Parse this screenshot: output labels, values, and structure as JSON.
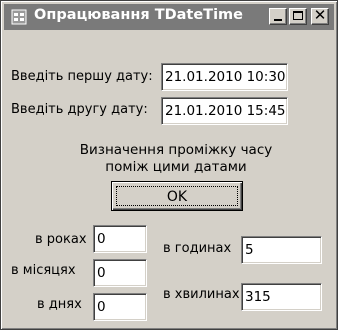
{
  "window": {
    "title": "Опрацювання TDateTime",
    "title_icon": "app-icon",
    "buttons": {
      "minimize": "minimize-icon",
      "maximize": "maximize-icon",
      "close": "✕"
    }
  },
  "form": {
    "first_date_label": "Введіть першу дату:",
    "first_date_value": "21.01.2010 10:30",
    "second_date_label": "Введіть другу дату:",
    "second_date_value": "21.01.2010 15:45",
    "caption": "Визначення проміжку часу поміж цими датами",
    "ok_label": "OK"
  },
  "results": {
    "years_label": "в роках",
    "years_value": "0",
    "months_label": "в місяцях",
    "months_value": "0",
    "days_label": "в днях",
    "days_value": "0",
    "hours_label": "в годинах",
    "hours_value": "5",
    "minutes_label": "в хвилинах",
    "minutes_value": "315"
  },
  "colors": {
    "face": "#d4d0c8",
    "titlebar": "#7a7a7a",
    "title_text": "#ffffff"
  }
}
